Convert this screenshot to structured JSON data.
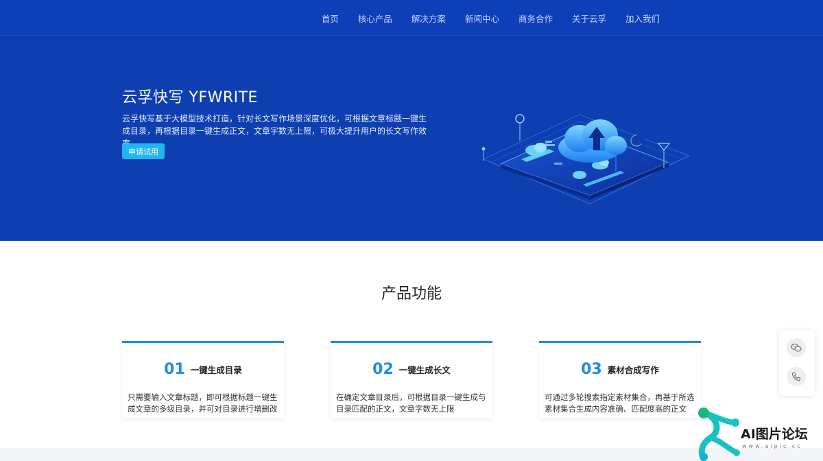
{
  "nav": {
    "items": [
      "首页",
      "核心产品",
      "解决方案",
      "新闻中心",
      "商务合作",
      "关于云孚",
      "加入我们"
    ]
  },
  "hero": {
    "title": "云孚快写 YFWRITE",
    "description": "云孚快写基于大模型技术打造，针对长文写作场景深度优化，可根据文章标题一键生成目录，再根据目录一键生成正文，文章字数无上限，可极大提升用户的长文写作效率。",
    "cta_label": "申请试用",
    "illustration_icon": "cloud-upload-isometric-icon"
  },
  "features": {
    "title": "产品功能",
    "cards": [
      {
        "num": "01",
        "name": "一键生成目录",
        "desc": "只需要输入文章标题，即可根据标题一键生成文章的多级目录，并可对目录进行增删改"
      },
      {
        "num": "02",
        "name": "一键生成长文",
        "desc": "在确定文章目录后，可根据目录一键生成与目录匹配的正文，文章字数无上限"
      },
      {
        "num": "03",
        "name": "素材合成写作",
        "desc": "可通过多轮搜索指定素材集合，再基于所选素材集合生成内容准确、匹配度高的正文"
      }
    ]
  },
  "side": {
    "wechat_icon": "wechat-icon",
    "phone_icon": "phone-icon"
  },
  "watermark": {
    "text": "AI图片论坛",
    "sub": "www.aipic.cc"
  },
  "colors": {
    "brand_blue": "#0d3fb0",
    "accent": "#1e8ee8",
    "cta": "#1fb6f0"
  }
}
